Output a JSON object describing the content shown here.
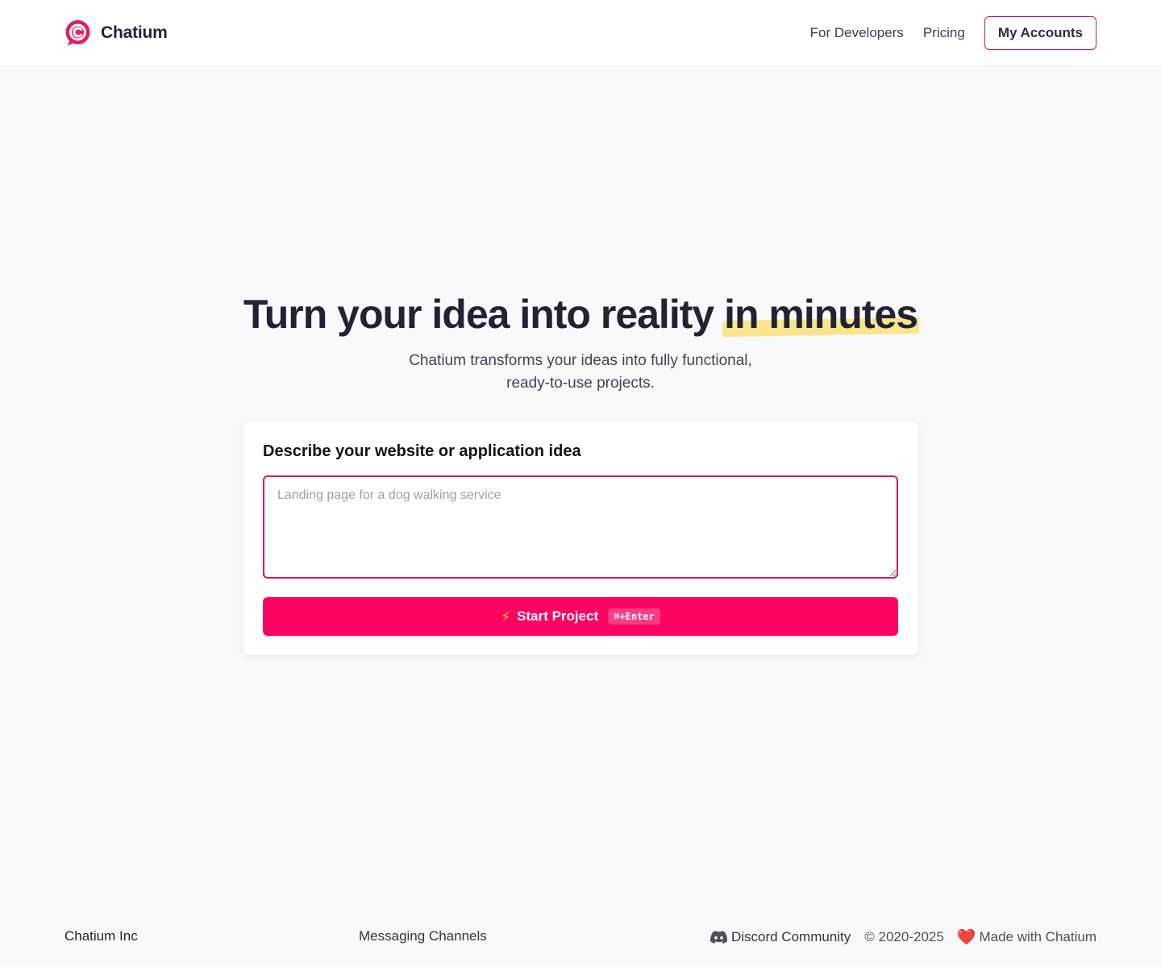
{
  "header": {
    "brand": "Chatium",
    "nav": {
      "developers": "For Developers",
      "pricing": "Pricing",
      "accounts": "My Accounts"
    }
  },
  "hero": {
    "title_main": "Turn your idea into reality ",
    "title_highlight": "in minutes",
    "subtitle_line1": "Chatium transforms your ideas into fully functional,",
    "subtitle_line2": "ready-to-use projects."
  },
  "form": {
    "label": "Describe your website or application idea",
    "value": "",
    "placeholder": "Landing page for a dog walking service",
    "button_label": "Start Project",
    "button_icon": "lightning-bolt-icon",
    "shortcut": "⌘+Enter"
  },
  "footer": {
    "company": "Chatium Inc",
    "channels": "Messaging Channels",
    "discord": "Discord Community",
    "copyright": "© 2020-2025",
    "made_with": "Made with Chatium"
  },
  "colors": {
    "brand": "#e8195e",
    "primary_button": "#fb0461",
    "highlight": "#fbe58a",
    "input_border": "#d6175f",
    "account_border": "#b3226a"
  }
}
